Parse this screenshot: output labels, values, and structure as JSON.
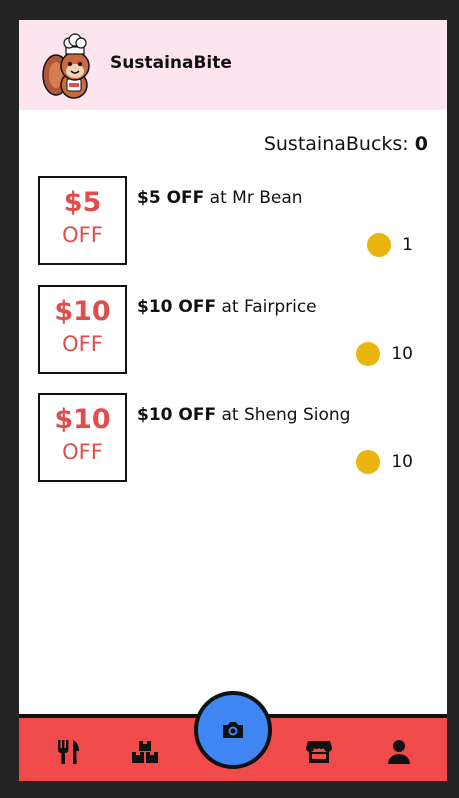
{
  "app": {
    "title": "SustainaBite"
  },
  "balance": {
    "label": "SustainaBucks:",
    "value": "0"
  },
  "offers": [
    {
      "badge_amount": "$5",
      "badge_off": "OFF",
      "title_bold": "$5 OFF",
      "title_rest": "at Mr Bean",
      "cost": "1"
    },
    {
      "badge_amount": "$10",
      "badge_off": "OFF",
      "title_bold": "$10 OFF",
      "title_rest": "at Fairprice",
      "cost": "10"
    },
    {
      "badge_amount": "$10",
      "badge_off": "OFF",
      "title_bold": "$10 OFF",
      "title_rest": "at Sheng Siong",
      "cost": "10"
    }
  ],
  "nav": {
    "items": [
      "utensils-icon",
      "boxes-icon",
      "camera-icon",
      "store-icon",
      "user-icon"
    ]
  },
  "colors": {
    "header_bg": "#fde5ef",
    "badge_red": "#e04d4d",
    "coin": "#eab40e",
    "nav_bg": "#f04a4a",
    "camera_bg": "#3f86f3"
  }
}
